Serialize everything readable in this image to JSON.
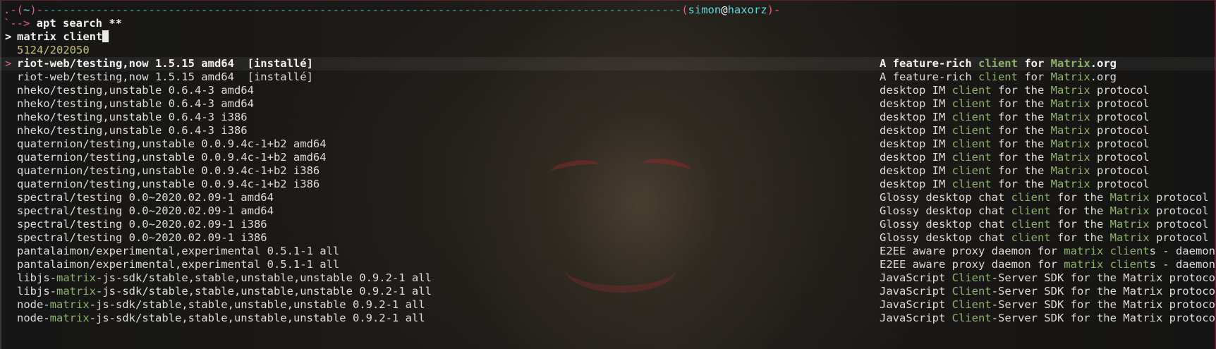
{
  "prompt": {
    "open": ".-(",
    "dir": "~",
    "close": ")-",
    "dashes": "-------------------------------------------------------------------------------------------------",
    "user_open": "(",
    "user": "simon",
    "at": "@",
    "host": "haxorz",
    "user_close": ")-",
    "arrow": "`--> ",
    "command": "apt search **"
  },
  "query": {
    "marker": ">",
    "text": "matrix client"
  },
  "count": "5124/202050",
  "selection_marker": ">",
  "results": [
    {
      "left": [
        {
          "t": "riot-web/testing,now 1.5.15 amd64  [installé]"
        }
      ],
      "right": [
        {
          "t": "A feature-rich "
        },
        {
          "t": "client",
          "h": "g"
        },
        {
          "t": " for "
        },
        {
          "t": "Matrix",
          "h": "g"
        },
        {
          "t": ".org"
        }
      ]
    },
    {
      "left": [
        {
          "t": "riot-web/testing,now 1.5.15 amd64  [installé]"
        }
      ],
      "right": [
        {
          "t": "A feature-rich "
        },
        {
          "t": "client",
          "h": "g"
        },
        {
          "t": " for "
        },
        {
          "t": "Matrix",
          "h": "g"
        },
        {
          "t": ".org"
        }
      ]
    },
    {
      "left": [
        {
          "t": "nheko/testing,unstable 0.6.4-3 amd64"
        }
      ],
      "right": [
        {
          "t": "desktop IM "
        },
        {
          "t": "client",
          "h": "g"
        },
        {
          "t": " for the "
        },
        {
          "t": "Matrix",
          "h": "g"
        },
        {
          "t": " protocol"
        }
      ]
    },
    {
      "left": [
        {
          "t": "nheko/testing,unstable 0.6.4-3 amd64"
        }
      ],
      "right": [
        {
          "t": "desktop IM "
        },
        {
          "t": "client",
          "h": "g"
        },
        {
          "t": " for the "
        },
        {
          "t": "Matrix",
          "h": "g"
        },
        {
          "t": " protocol"
        }
      ]
    },
    {
      "left": [
        {
          "t": "nheko/testing,unstable 0.6.4-3 i386"
        }
      ],
      "right": [
        {
          "t": "desktop IM "
        },
        {
          "t": "client",
          "h": "g"
        },
        {
          "t": " for the "
        },
        {
          "t": "Matrix",
          "h": "g"
        },
        {
          "t": " protocol"
        }
      ]
    },
    {
      "left": [
        {
          "t": "nheko/testing,unstable 0.6.4-3 i386"
        }
      ],
      "right": [
        {
          "t": "desktop IM "
        },
        {
          "t": "client",
          "h": "g"
        },
        {
          "t": " for the "
        },
        {
          "t": "Matrix",
          "h": "g"
        },
        {
          "t": " protocol"
        }
      ]
    },
    {
      "left": [
        {
          "t": "quaternion/testing,unstable 0.0.9.4c-1+b2 amd64"
        }
      ],
      "right": [
        {
          "t": "desktop IM "
        },
        {
          "t": "client",
          "h": "g"
        },
        {
          "t": " for the "
        },
        {
          "t": "Matrix",
          "h": "g"
        },
        {
          "t": " protocol"
        }
      ]
    },
    {
      "left": [
        {
          "t": "quaternion/testing,unstable 0.0.9.4c-1+b2 amd64"
        }
      ],
      "right": [
        {
          "t": "desktop IM "
        },
        {
          "t": "client",
          "h": "g"
        },
        {
          "t": " for the "
        },
        {
          "t": "Matrix",
          "h": "g"
        },
        {
          "t": " protocol"
        }
      ]
    },
    {
      "left": [
        {
          "t": "quaternion/testing,unstable 0.0.9.4c-1+b2 i386"
        }
      ],
      "right": [
        {
          "t": "desktop IM "
        },
        {
          "t": "client",
          "h": "g"
        },
        {
          "t": " for the "
        },
        {
          "t": "Matrix",
          "h": "g"
        },
        {
          "t": " protocol"
        }
      ]
    },
    {
      "left": [
        {
          "t": "quaternion/testing,unstable 0.0.9.4c-1+b2 i386"
        }
      ],
      "right": [
        {
          "t": "desktop IM "
        },
        {
          "t": "client",
          "h": "g"
        },
        {
          "t": " for the "
        },
        {
          "t": "Matrix",
          "h": "g"
        },
        {
          "t": " protocol"
        }
      ]
    },
    {
      "left": [
        {
          "t": "spectral/testing 0.0~2020.02.09-1 amd64"
        }
      ],
      "right": [
        {
          "t": "Glossy desktop chat "
        },
        {
          "t": "client",
          "h": "g"
        },
        {
          "t": " for the "
        },
        {
          "t": "Matrix",
          "h": "g"
        },
        {
          "t": " protocol"
        }
      ]
    },
    {
      "left": [
        {
          "t": "spectral/testing 0.0~2020.02.09-1 amd64"
        }
      ],
      "right": [
        {
          "t": "Glossy desktop chat "
        },
        {
          "t": "client",
          "h": "g"
        },
        {
          "t": " for the "
        },
        {
          "t": "Matrix",
          "h": "g"
        },
        {
          "t": " protocol"
        }
      ]
    },
    {
      "left": [
        {
          "t": "spectral/testing 0.0~2020.02.09-1 i386"
        }
      ],
      "right": [
        {
          "t": "Glossy desktop chat "
        },
        {
          "t": "client",
          "h": "g"
        },
        {
          "t": " for the "
        },
        {
          "t": "Matrix",
          "h": "g"
        },
        {
          "t": " protocol"
        }
      ]
    },
    {
      "left": [
        {
          "t": "spectral/testing 0.0~2020.02.09-1 i386"
        }
      ],
      "right": [
        {
          "t": "Glossy desktop chat "
        },
        {
          "t": "client",
          "h": "g"
        },
        {
          "t": " for the "
        },
        {
          "t": "Matrix",
          "h": "g"
        },
        {
          "t": " protocol"
        }
      ]
    },
    {
      "left": [
        {
          "t": "pantalaimon/experimental,experimental 0.5.1-1 all"
        }
      ],
      "right": [
        {
          "t": "E2EE aware proxy daemon for "
        },
        {
          "t": "matrix",
          "h": "g"
        },
        {
          "t": " "
        },
        {
          "t": "client",
          "h": "g"
        },
        {
          "t": "s - daemon"
        }
      ]
    },
    {
      "left": [
        {
          "t": "pantalaimon/experimental,experimental 0.5.1-1 all"
        }
      ],
      "right": [
        {
          "t": "E2EE aware proxy daemon for "
        },
        {
          "t": "matrix",
          "h": "g"
        },
        {
          "t": " "
        },
        {
          "t": "client",
          "h": "g"
        },
        {
          "t": "s - daemon"
        }
      ]
    },
    {
      "left": [
        {
          "t": "libjs-"
        },
        {
          "t": "matrix",
          "h": "g"
        },
        {
          "t": "-js-sdk/stable,stable,unstable,unstable 0.9.2-1 all"
        }
      ],
      "right": [
        {
          "t": "JavaScript "
        },
        {
          "t": "Client",
          "h": "g"
        },
        {
          "t": "-Server SDK for the Matrix protocol"
        }
      ]
    },
    {
      "left": [
        {
          "t": "libjs-"
        },
        {
          "t": "matrix",
          "h": "g"
        },
        {
          "t": "-js-sdk/stable,stable,unstable,unstable 0.9.2-1 all"
        }
      ],
      "right": [
        {
          "t": "JavaScript "
        },
        {
          "t": "Client",
          "h": "g"
        },
        {
          "t": "-Server SDK for the Matrix protocol"
        }
      ]
    },
    {
      "left": [
        {
          "t": "node-"
        },
        {
          "t": "matrix",
          "h": "g"
        },
        {
          "t": "-js-sdk/stable,stable,unstable,unstable 0.9.2-1 all"
        }
      ],
      "right": [
        {
          "t": "JavaScript "
        },
        {
          "t": "Client",
          "h": "g"
        },
        {
          "t": "-Server SDK for the Matrix protocol"
        }
      ]
    },
    {
      "left": [
        {
          "t": "node-"
        },
        {
          "t": "matrix",
          "h": "g"
        },
        {
          "t": "-js-sdk/stable,stable,unstable,unstable 0.9.2-1 all"
        }
      ],
      "right": [
        {
          "t": "JavaScript "
        },
        {
          "t": "Client",
          "h": "g"
        },
        {
          "t": "-Server SDK for the Matrix protocol"
        }
      ]
    }
  ],
  "colors": {
    "prompt_dash": "#e0607e",
    "user": "#5fd7d7",
    "match_highlight": "#8fb26a",
    "count": "#c8bf78",
    "selection_marker": "#e0607e"
  }
}
